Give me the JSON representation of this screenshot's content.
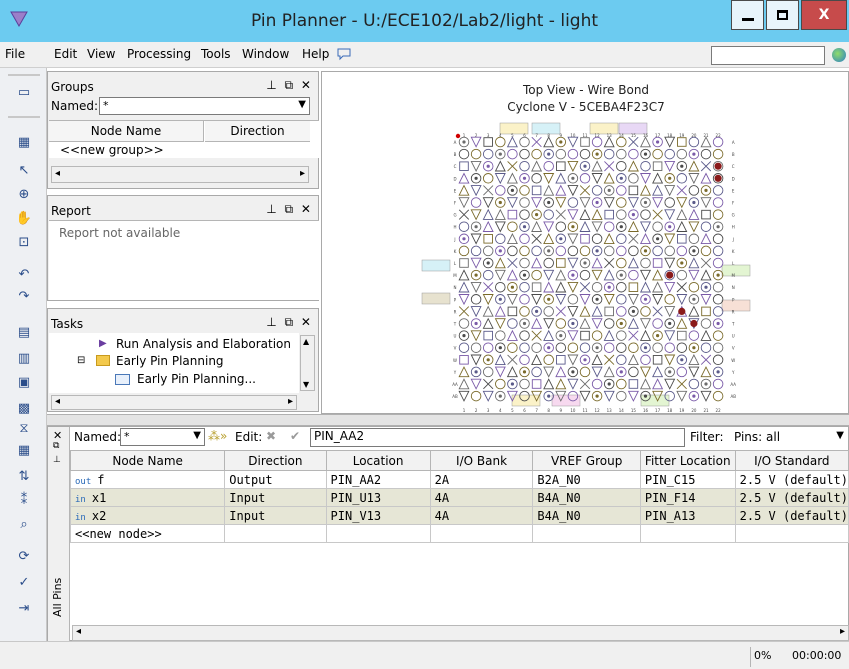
{
  "window": {
    "title": "Pin Planner - U:/ECE102/Lab2/light - light",
    "close": "X"
  },
  "menu": [
    "File",
    "Edit",
    "View",
    "Processing",
    "Tools",
    "Window",
    "Help"
  ],
  "groups": {
    "title": "Groups",
    "named_label": "Named:",
    "named_value": "*",
    "col_node": "Node Name",
    "col_dir": "Direction",
    "new_group": "<<new group>>"
  },
  "report": {
    "title": "Report",
    "empty": "Report not available"
  },
  "tasks": {
    "title": "Tasks",
    "items": [
      "Run Analysis and Elaboration",
      "Early Pin Planning",
      "Early Pin Planning..."
    ]
  },
  "chip": {
    "title": "Top View - Wire Bond",
    "device": "Cyclone V - 5CEBA4F23C7",
    "rows": [
      "A",
      "B",
      "C",
      "D",
      "E",
      "F",
      "G",
      "H",
      "J",
      "K",
      "L",
      "M",
      "N",
      "P",
      "R",
      "T",
      "U",
      "V",
      "W",
      "Y",
      "AA",
      "AB"
    ],
    "cols": [
      "1",
      "2",
      "3",
      "4",
      "5",
      "6",
      "7",
      "8",
      "9",
      "10",
      "11",
      "12",
      "13",
      "14",
      "15",
      "16",
      "17",
      "18",
      "19",
      "20",
      "21",
      "22"
    ]
  },
  "pin_toolbar": {
    "named_label": "Named:",
    "named_value": "*",
    "edit_label": "Edit:",
    "edit_value": "PIN_AA2",
    "filter_label": "Filter:",
    "filter_value": "Pins: all",
    "tab_label": "All Pins"
  },
  "pins": {
    "columns": [
      "Node Name",
      "Direction",
      "Location",
      "I/O Bank",
      "VREF Group",
      "Fitter Location",
      "I/O Standard"
    ],
    "rows": [
      {
        "name": "f",
        "dir_icon": "out",
        "direction": "Output",
        "location": "PIN_AA2",
        "bank": "2A",
        "vref": "B2A_N0",
        "fitter": "PIN_C15",
        "std": "2.5 V (default)"
      },
      {
        "name": "x1",
        "dir_icon": "in",
        "direction": "Input",
        "location": "PIN_U13",
        "bank": "4A",
        "vref": "B4A_N0",
        "fitter": "PIN_F14",
        "std": "2.5 V (default)"
      },
      {
        "name": "x2",
        "dir_icon": "in",
        "direction": "Input",
        "location": "PIN_V13",
        "bank": "4A",
        "vref": "B4A_N0",
        "fitter": "PIN_A13",
        "std": "2.5 V (default)"
      }
    ],
    "new_node": "<<new node>>"
  },
  "status": {
    "progress": "0%",
    "time": "00:00:00"
  },
  "colors": {
    "titlebar": "#6ccbf0",
    "close": "#c74b4b",
    "selected_row": "#e6e6d6"
  },
  "icons": [
    "app-icon",
    "minimize-icon",
    "maximize-icon",
    "close-icon",
    "globe-icon",
    "run-icon",
    "folder-icon",
    "task-icon"
  ]
}
